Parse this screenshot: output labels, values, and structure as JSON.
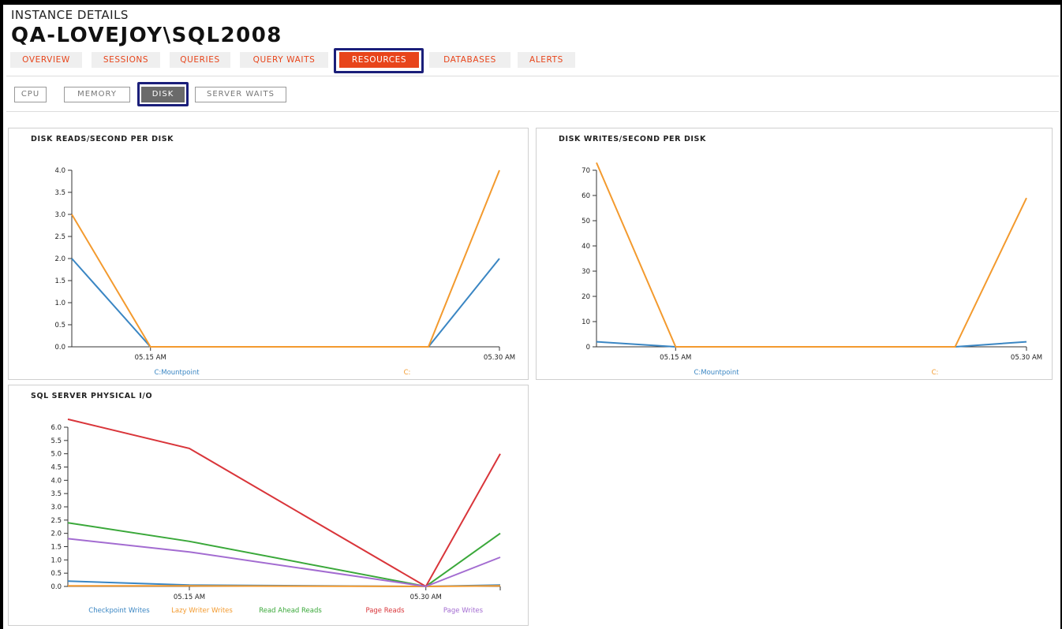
{
  "header": {
    "kicker": "INSTANCE DETAILS",
    "title": "QA-LOVEJOY\\SQL2008"
  },
  "tabs": [
    {
      "label": "OVERVIEW",
      "active": false
    },
    {
      "label": "SESSIONS",
      "active": false
    },
    {
      "label": "QUERIES",
      "active": false
    },
    {
      "label": "QUERY WAITS",
      "active": false
    },
    {
      "label": "RESOURCES",
      "active": true
    },
    {
      "label": "DATABASES",
      "active": false
    },
    {
      "label": "ALERTS",
      "active": false
    }
  ],
  "subtabs": [
    {
      "label": "CPU",
      "active": false
    },
    {
      "label": "MEMORY",
      "active": false
    },
    {
      "label": "DISK",
      "active": true
    },
    {
      "label": "SERVER WAITS",
      "active": false
    }
  ],
  "colors": {
    "accent": "#e8451b",
    "frame": "#1b1f7a",
    "blue": "#3a86c3",
    "orange": "#f39a2e",
    "green": "#3aa83a",
    "red": "#d9353a",
    "purple": "#a36cd1"
  },
  "chart_data": [
    {
      "type": "line",
      "title": "DISK READS/SECOND PER DISK",
      "x": [
        "",
        "05.15 AM",
        "",
        "05.30 AM"
      ],
      "ylim": [
        0,
        4.0
      ],
      "yticks": [
        "0.0",
        "0.5",
        "1.0",
        "1.5",
        "2.0",
        "2.5",
        "3.0",
        "3.5",
        "4.0"
      ],
      "series": [
        {
          "name": "C:Mountpoint",
          "color": "#3a86c3",
          "values": [
            2.0,
            0,
            0,
            2.0
          ]
        },
        {
          "name": "C:",
          "color": "#f39a2e",
          "values": [
            3.0,
            0,
            0,
            4.0
          ]
        }
      ]
    },
    {
      "type": "line",
      "title": "DISK WRITES/SECOND PER DISK",
      "x": [
        "",
        "05.15 AM",
        "",
        "05.30 AM"
      ],
      "ylim": [
        0,
        70
      ],
      "yticks": [
        "0",
        "10",
        "20",
        "30",
        "40",
        "50",
        "60",
        "70"
      ],
      "series": [
        {
          "name": "C:Mountpoint",
          "color": "#3a86c3",
          "values": [
            2,
            0,
            0,
            2
          ]
        },
        {
          "name": "C:",
          "color": "#f39a2e",
          "values": [
            73,
            0,
            0,
            59
          ]
        }
      ]
    },
    {
      "type": "line",
      "title": "SQL SERVER PHYSICAL I/O",
      "x": [
        "",
        "05.15 AM",
        "05.30 AM",
        ""
      ],
      "ylim": [
        0,
        6.0
      ],
      "yticks": [
        "0.0",
        "0.5",
        "1.0",
        "1.5",
        "2.0",
        "2.5",
        "3.0",
        "3.5",
        "4.0",
        "4.5",
        "5.0",
        "5.5",
        "6.0"
      ],
      "series": [
        {
          "name": "Checkpoint Writes",
          "color": "#3a86c3",
          "values": [
            0.2,
            0.05,
            0,
            0.05
          ]
        },
        {
          "name": "Lazy Writer Writes",
          "color": "#f39a2e",
          "values": [
            0.02,
            0.02,
            0,
            0.02
          ]
        },
        {
          "name": "Read Ahead Reads",
          "color": "#3aa83a",
          "values": [
            2.4,
            1.7,
            0,
            2.0
          ]
        },
        {
          "name": "Page Reads",
          "color": "#d9353a",
          "values": [
            6.3,
            5.2,
            0,
            5.0
          ]
        },
        {
          "name": "Page Writes",
          "color": "#a36cd1",
          "values": [
            1.8,
            1.3,
            0,
            1.1
          ]
        }
      ]
    }
  ]
}
